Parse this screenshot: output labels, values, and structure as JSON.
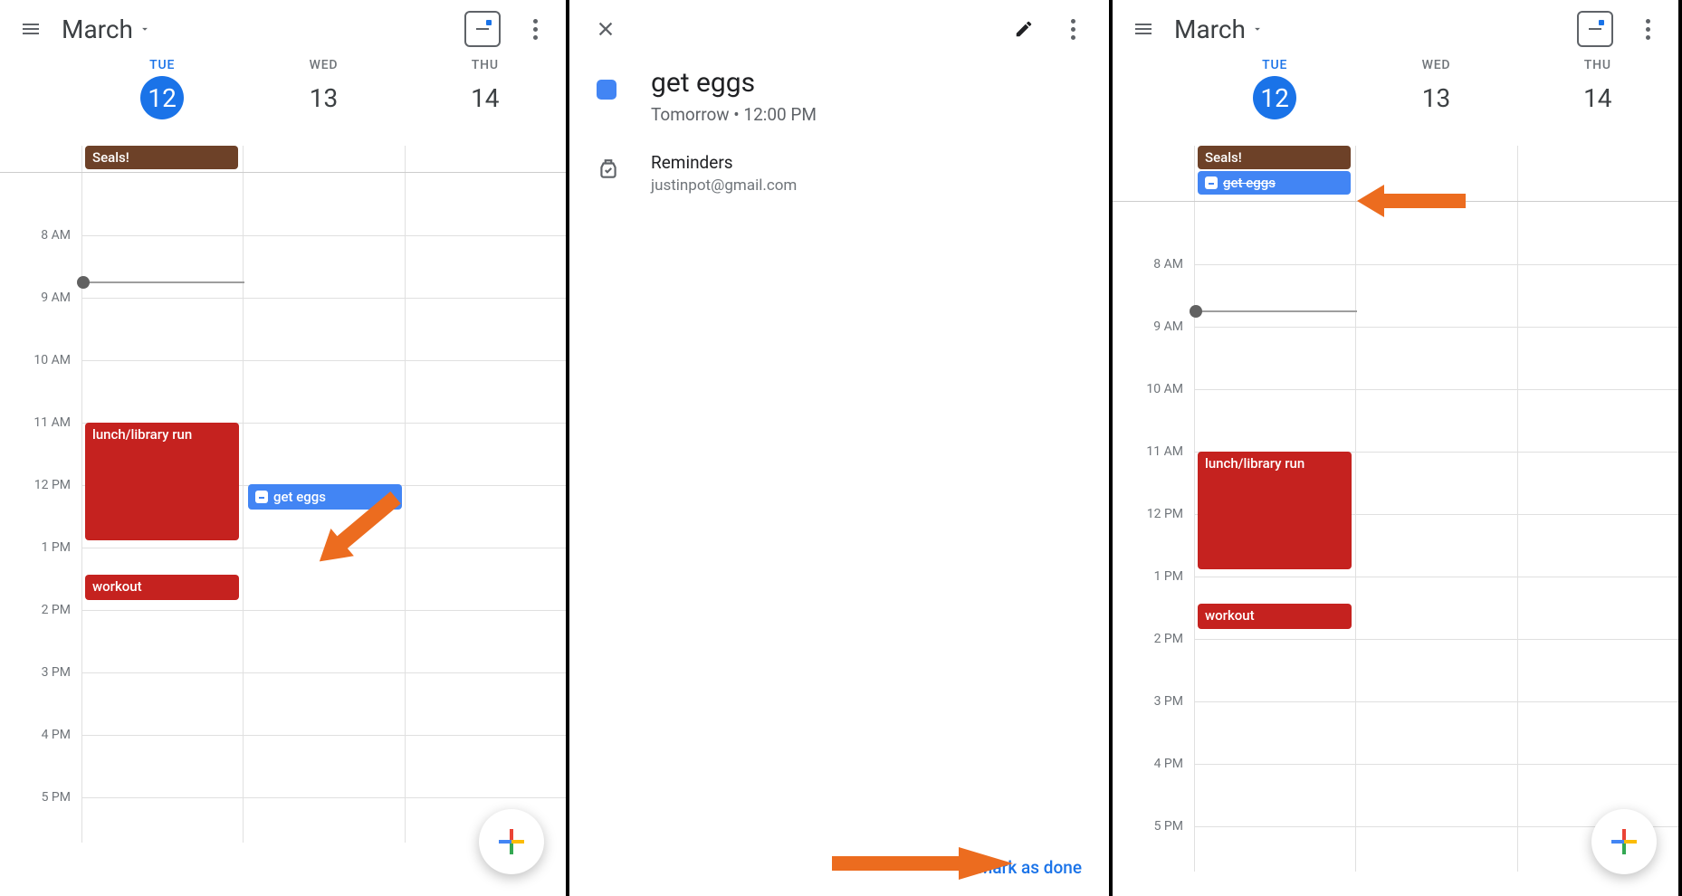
{
  "header": {
    "month": "March"
  },
  "days": [
    {
      "name": "TUE",
      "num": "12",
      "active": true
    },
    {
      "name": "WED",
      "num": "13",
      "active": false
    },
    {
      "name": "THU",
      "num": "14",
      "active": false
    }
  ],
  "hours": [
    "8 AM",
    "9 AM",
    "10 AM",
    "11 AM",
    "12 PM",
    "1 PM",
    "2 PM",
    "3 PM",
    "4 PM",
    "5 PM"
  ],
  "events": {
    "seals": "Seals!",
    "lunch": "lunch/library run",
    "workout": "workout",
    "get_eggs": "get eggs",
    "get_eggs_done": "get eggs"
  },
  "detail": {
    "title": "get eggs",
    "when": "Tomorrow  •  12:00 PM",
    "reminders": "Reminders",
    "email": "justinpot@gmail.com",
    "mark_done": "Mark as done"
  }
}
